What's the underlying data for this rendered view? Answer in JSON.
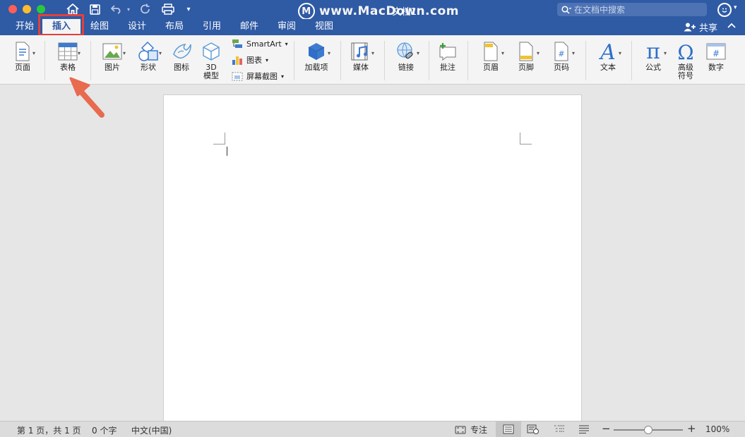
{
  "window": {
    "title": "文档1",
    "watermark": "www.MacDown.com",
    "watermark_logo": "M"
  },
  "quick_access": [
    "home-icon",
    "save-icon",
    "undo-icon",
    "redo-icon",
    "print-icon",
    "customize-icon"
  ],
  "search": {
    "placeholder": "在文档中搜索"
  },
  "tabs": [
    {
      "label": "开始"
    },
    {
      "label": "插入"
    },
    {
      "label": "绘图"
    },
    {
      "label": "设计"
    },
    {
      "label": "布局"
    },
    {
      "label": "引用"
    },
    {
      "label": "邮件"
    },
    {
      "label": "审阅"
    },
    {
      "label": "视图"
    }
  ],
  "active_tab": "插入",
  "share_label": "共享",
  "ribbon": {
    "page": "页面",
    "table": "表格",
    "picture": "图片",
    "shape": "形状",
    "icon": "图标",
    "model3d_1": "3D",
    "model3d_2": "模型",
    "smartart": "SmartArt",
    "chart": "图表",
    "screenshot": "屏幕截图",
    "addins": "加载项",
    "media": "媒体",
    "link": "链接",
    "comment": "批注",
    "header": "页眉",
    "footer": "页脚",
    "page_number": "页码",
    "text": "文本",
    "equation": "公式",
    "symbol_1": "高级",
    "symbol_2": "符号",
    "number": "数字"
  },
  "status": {
    "page_info": "第 1 页，共 1 页",
    "word_count": "0 个字",
    "language": "中文(中国)",
    "focus": "专注",
    "zoom": "100%",
    "zoom_level_fraction": 0.5
  },
  "colors": {
    "titlebar": "#2f5aa4",
    "highlight": "#e0413d",
    "accent_blue": "#2f6fc9"
  }
}
